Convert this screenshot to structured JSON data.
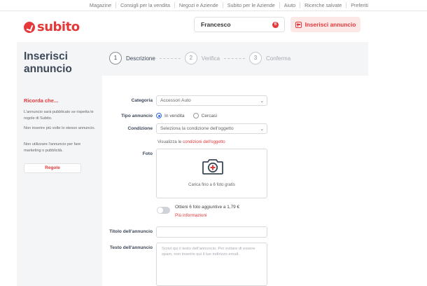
{
  "topnav": {
    "links": [
      "Magazine",
      "Consigli per la vendita",
      "Negozi e Aziende",
      "Subito per le Aziende",
      "Aiuto",
      "Ricerche salvate",
      "Preferiti"
    ]
  },
  "header": {
    "logo_text": "subito",
    "user_name": "Francesco",
    "notification_count": "6",
    "insert_button_label": "Inserisci annuncio"
  },
  "page": {
    "title": "Inserisci annuncio"
  },
  "steps": [
    {
      "number": "1",
      "label": "Descrizione",
      "active": true
    },
    {
      "number": "2",
      "label": "Verifica",
      "active": false
    },
    {
      "number": "3",
      "label": "Conferma",
      "active": false
    }
  ],
  "sidebar": {
    "title": "Ricorda che...",
    "paragraphs": [
      "L'annuncio sarà pubblicato se rispetta le regole di Subito.",
      "Non inserire più volte lo stesso annuncio.",
      "Non utilizzare l'annuncio per fare marketing o pubblicità."
    ],
    "rules_button": "Regole"
  },
  "form": {
    "category_label": "Categoria",
    "category_value": "Accessori Auto",
    "type_label": "Tipo annuncio",
    "type_options": [
      "In vendita",
      "Cercasi"
    ],
    "type_selected": "In vendita",
    "condition_label": "Condizione",
    "condition_placeholder": "Seleziona la condizione dell'oggetto",
    "condition_link_prefix": "Visualizza le ",
    "condition_link_text": "condizioni dell'oggetto",
    "photo_label": "Foto",
    "photo_hint": "Carica fino a 6 foto gratis",
    "extra_photos_text": "Ottieni 6 foto aggiuntive a 1,79 €",
    "more_info_link": "Più informazioni",
    "title_label": "Titolo dell'annuncio",
    "title_value": "",
    "text_label": "Testo dell'annuncio",
    "text_placeholder": "Scrivi qui il testo dell'annuncio. Per evitare di essere spam, non inserire qui il tuo indirizzo email."
  },
  "colors": {
    "brand_red": "#e4383a",
    "band_gray": "#f4f5f7",
    "radio_blue": "#2d6cdf"
  }
}
